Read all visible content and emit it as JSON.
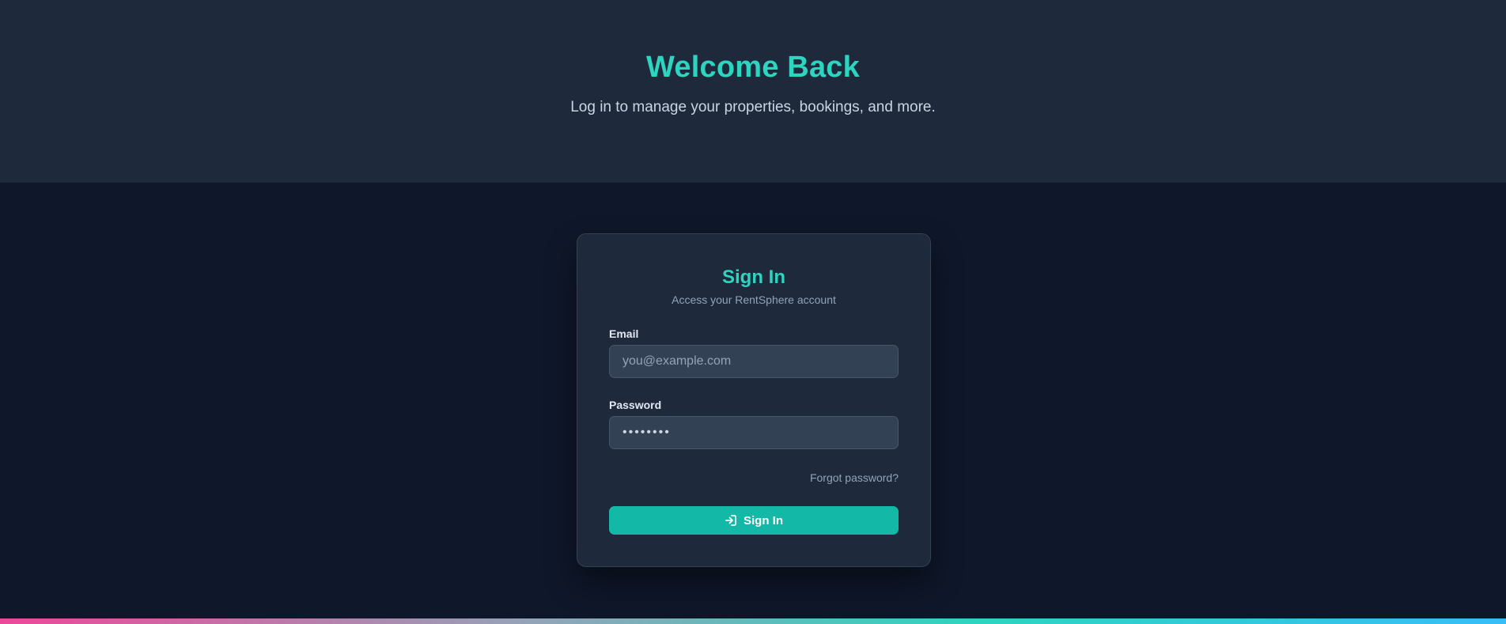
{
  "hero": {
    "title": "Welcome Back",
    "subtitle": "Log in to manage your properties, bookings, and more."
  },
  "login_card": {
    "title": "Sign In",
    "subtitle": "Access your RentSphere account",
    "email": {
      "label": "Email",
      "placeholder": "you@example.com",
      "value": ""
    },
    "password": {
      "label": "Password",
      "value": "••••••••"
    },
    "forgot_link": "Forgot password?",
    "submit": {
      "label": "Sign In",
      "icon": "sign-in-icon"
    }
  },
  "colors": {
    "accent": "#2dd4bf",
    "button": "#14b8a6",
    "hero_background": "#1e293b",
    "page_background": "#0f172a",
    "card_background": "#1e293b",
    "input_background": "#334155"
  }
}
